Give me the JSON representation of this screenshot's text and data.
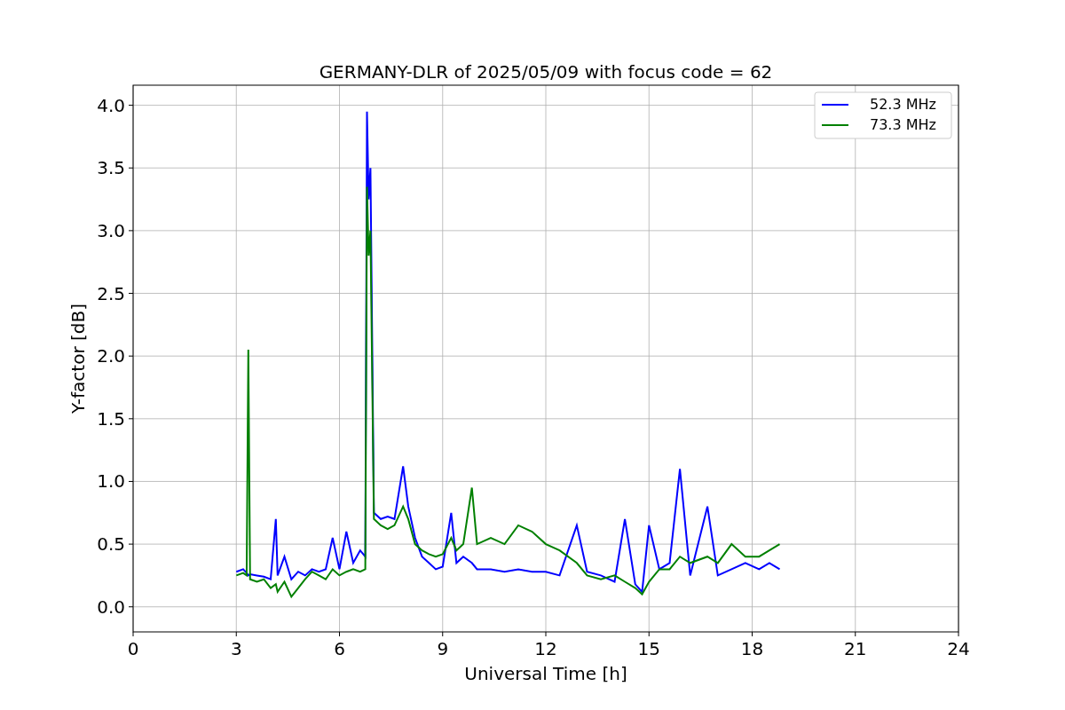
{
  "chart_data": {
    "type": "line",
    "title": "GERMANY-DLR of 2025/05/09 with focus code = 62",
    "xlabel": "Universal Time [h]",
    "ylabel": "Y-factor [dB]",
    "x": [
      3.0,
      3.2,
      3.3,
      3.35,
      3.4,
      3.6,
      3.8,
      4.0,
      4.15,
      4.2,
      4.4,
      4.6,
      4.8,
      5.0,
      5.2,
      5.4,
      5.6,
      5.8,
      6.0,
      6.2,
      6.4,
      6.6,
      6.75,
      6.8,
      6.85,
      6.9,
      7.0,
      7.2,
      7.4,
      7.6,
      7.85,
      8.0,
      8.2,
      8.4,
      8.6,
      8.8,
      9.0,
      9.25,
      9.4,
      9.6,
      9.85,
      10.0,
      10.4,
      10.8,
      11.2,
      11.6,
      12.0,
      12.4,
      12.9,
      13.2,
      13.6,
      14.0,
      14.3,
      14.6,
      14.8,
      15.0,
      15.3,
      15.6,
      15.9,
      16.2,
      16.7,
      17.0,
      17.4,
      17.8,
      18.2,
      18.5,
      18.8
    ],
    "series": [
      {
        "name": "52.3 MHz",
        "color": "#0000ff",
        "values": [
          0.28,
          0.3,
          0.27,
          0.25,
          0.26,
          0.25,
          0.24,
          0.22,
          0.7,
          0.25,
          0.4,
          0.22,
          0.28,
          0.25,
          0.3,
          0.28,
          0.3,
          0.55,
          0.3,
          0.6,
          0.35,
          0.45,
          0.4,
          3.95,
          3.25,
          3.5,
          0.75,
          0.7,
          0.72,
          0.7,
          1.12,
          0.8,
          0.55,
          0.4,
          0.35,
          0.3,
          0.32,
          0.75,
          0.35,
          0.4,
          0.35,
          0.3,
          0.3,
          0.28,
          0.3,
          0.28,
          0.28,
          0.25,
          0.65,
          0.28,
          0.25,
          0.2,
          0.7,
          0.18,
          0.12,
          0.65,
          0.3,
          0.35,
          1.1,
          0.25,
          0.8,
          0.25,
          0.3,
          0.35,
          0.3,
          0.35,
          0.3
        ]
      },
      {
        "name": "73.3 MHz",
        "color": "#008000",
        "values": [
          0.25,
          0.27,
          0.25,
          2.05,
          0.22,
          0.2,
          0.22,
          0.15,
          0.18,
          0.12,
          0.2,
          0.08,
          0.15,
          0.22,
          0.28,
          0.25,
          0.22,
          0.3,
          0.25,
          0.28,
          0.3,
          0.28,
          0.3,
          3.35,
          2.8,
          3.0,
          0.7,
          0.65,
          0.62,
          0.65,
          0.8,
          0.7,
          0.5,
          0.45,
          0.42,
          0.4,
          0.42,
          0.55,
          0.45,
          0.5,
          0.95,
          0.5,
          0.55,
          0.5,
          0.65,
          0.6,
          0.5,
          0.45,
          0.35,
          0.25,
          0.22,
          0.25,
          0.2,
          0.15,
          0.1,
          0.2,
          0.3,
          0.3,
          0.4,
          0.35,
          0.4,
          0.35,
          0.5,
          0.4,
          0.4,
          0.45,
          0.5
        ]
      }
    ],
    "grid": true,
    "legend": true,
    "xlim": [
      0,
      24
    ],
    "ylim": [
      -0.2,
      4.16
    ],
    "xticks": [
      0,
      3,
      6,
      9,
      12,
      15,
      18,
      21,
      24
    ],
    "yticks": [
      {
        "value": 0,
        "label": "0.0"
      },
      {
        "value": 0.5,
        "label": "0.5"
      },
      {
        "value": 1,
        "label": "1.0"
      },
      {
        "value": 1.5,
        "label": "1.5"
      },
      {
        "value": 2,
        "label": "2.0"
      },
      {
        "value": 2.5,
        "label": "2.5"
      },
      {
        "value": 3,
        "label": "3.0"
      },
      {
        "value": 3.5,
        "label": "3.5"
      },
      {
        "value": 4,
        "label": "4.0"
      }
    ]
  }
}
